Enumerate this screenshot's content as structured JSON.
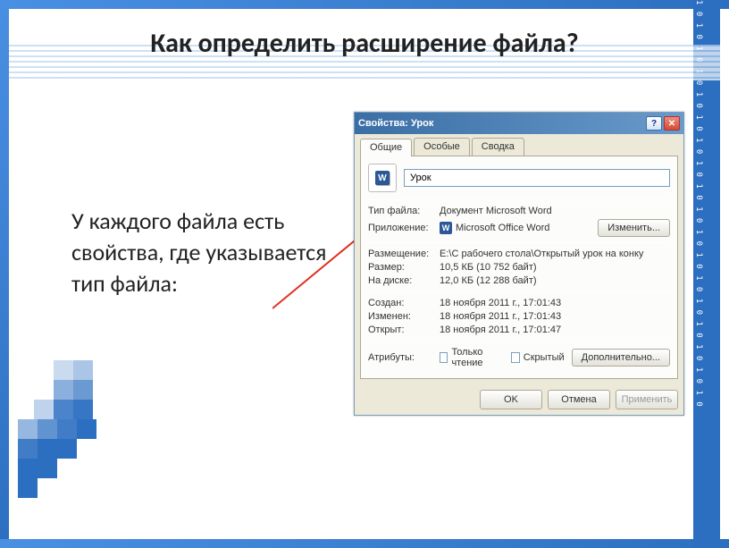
{
  "slide": {
    "title": "Как определить расширение файла?",
    "body": "У каждого файла есть свойства, где указывается тип файла:"
  },
  "dialog": {
    "window_title": "Свойства: Урок",
    "help_glyph": "?",
    "close_glyph": "✕",
    "tabs": {
      "general": "Общие",
      "special": "Особые",
      "summary": "Сводка"
    },
    "filename": "Урок",
    "labels": {
      "filetype": "Тип файла:",
      "app": "Приложение:",
      "location": "Размещение:",
      "size": "Размер:",
      "ondisk": "На диске:",
      "created": "Создан:",
      "modified": "Изменен:",
      "opened": "Открыт:",
      "attributes": "Атрибуты:",
      "readonly": "Только чтение",
      "hidden": "Скрытый"
    },
    "values": {
      "filetype": "Документ Microsoft Word",
      "app": "Microsoft Office Word",
      "location": "E:\\С рабочего стола\\Открытый урок на конку",
      "size": "10,5 КБ (10 752 байт)",
      "ondisk": "12,0 КБ (12 288 байт)",
      "created": "18 ноября 2011 г., 17:01:43",
      "modified": "18 ноября 2011 г., 17:01:43",
      "opened": "18 ноября 2011 г., 17:01:47"
    },
    "buttons": {
      "change": "Изменить...",
      "advanced": "Дополнительно...",
      "ok": "OK",
      "cancel": "Отмена",
      "apply": "Применить"
    }
  }
}
